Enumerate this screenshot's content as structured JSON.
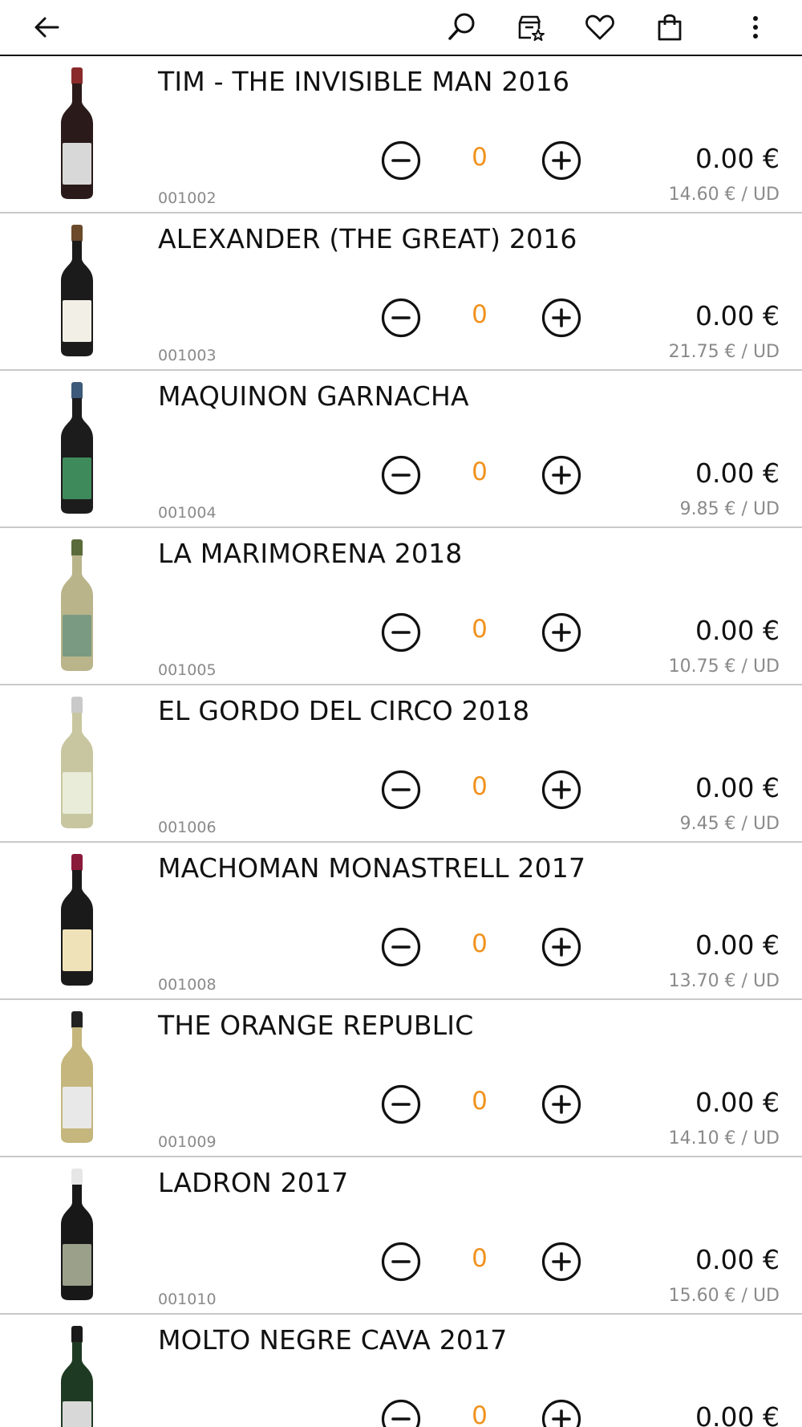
{
  "toolbar": {
    "icons": [
      "arrow-left-icon",
      "search-icon",
      "catalog-star-icon",
      "heart-icon",
      "shopping-bag-icon",
      "more-vertical-icon"
    ]
  },
  "colors": {
    "accent": "#f0921e",
    "text": "#111111",
    "muted": "#8a8a8a",
    "divider": "#c9c9c9"
  },
  "products": [
    {
      "name": "TIM - THE INVISIBLE MAN 2016",
      "code": "001002",
      "qty": "0",
      "total": "0.00 €",
      "unit_price": "14.60 € / UD",
      "bottle": {
        "glass": "#2a1a1a",
        "cap": "#8a2a2a",
        "label": "#d8d8d8"
      }
    },
    {
      "name": "ALEXANDER (THE GREAT) 2016",
      "code": "001003",
      "qty": "0",
      "total": "0.00 €",
      "unit_price": "21.75 € / UD",
      "bottle": {
        "glass": "#1b1b1b",
        "cap": "#6a4a2a",
        "label": "#f2efe6"
      }
    },
    {
      "name": "MAQUINON GARNACHA",
      "code": "001004",
      "qty": "0",
      "total": "0.00 €",
      "unit_price": "9.85 € / UD",
      "bottle": {
        "glass": "#1c1c1c",
        "cap": "#3d5a7a",
        "label": "#3f8a5a"
      }
    },
    {
      "name": "LA MARIMORENA 2018",
      "code": "001005",
      "qty": "0",
      "total": "0.00 €",
      "unit_price": "10.75 € / UD",
      "bottle": {
        "glass": "#b9b48a",
        "cap": "#5a6a3a",
        "label": "#7a9a82"
      }
    },
    {
      "name": "EL GORDO DEL CIRCO 2018",
      "code": "001006",
      "qty": "0",
      "total": "0.00 €",
      "unit_price": "9.45 € / UD",
      "bottle": {
        "glass": "#c8c6a0",
        "cap": "#c9c9c9",
        "label": "#e8ecd8"
      }
    },
    {
      "name": "MACHOMAN MONASTRELL 2017",
      "code": "001008",
      "qty": "0",
      "total": "0.00 €",
      "unit_price": "13.70 € / UD",
      "bottle": {
        "glass": "#1a1a1a",
        "cap": "#8a1a3a",
        "label": "#efe2b8"
      }
    },
    {
      "name": "THE ORANGE REPUBLIC",
      "code": "001009",
      "qty": "0",
      "total": "0.00 €",
      "unit_price": "14.10 € / UD",
      "bottle": {
        "glass": "#c4b67c",
        "cap": "#222222",
        "label": "#e8e8e8"
      }
    },
    {
      "name": "LADRON 2017",
      "code": "001010",
      "qty": "0",
      "total": "0.00 €",
      "unit_price": "15.60 € / UD",
      "bottle": {
        "glass": "#181818",
        "cap": "#e6e6e6",
        "label": "#9aa08a"
      }
    },
    {
      "name": "MOLTO NEGRE CAVA 2017",
      "code": "",
      "qty": "0",
      "total": "0.00 €",
      "unit_price": "",
      "bottle": {
        "glass": "#1f3a22",
        "cap": "#1a1a1a",
        "label": "#d8d8d8"
      }
    }
  ]
}
